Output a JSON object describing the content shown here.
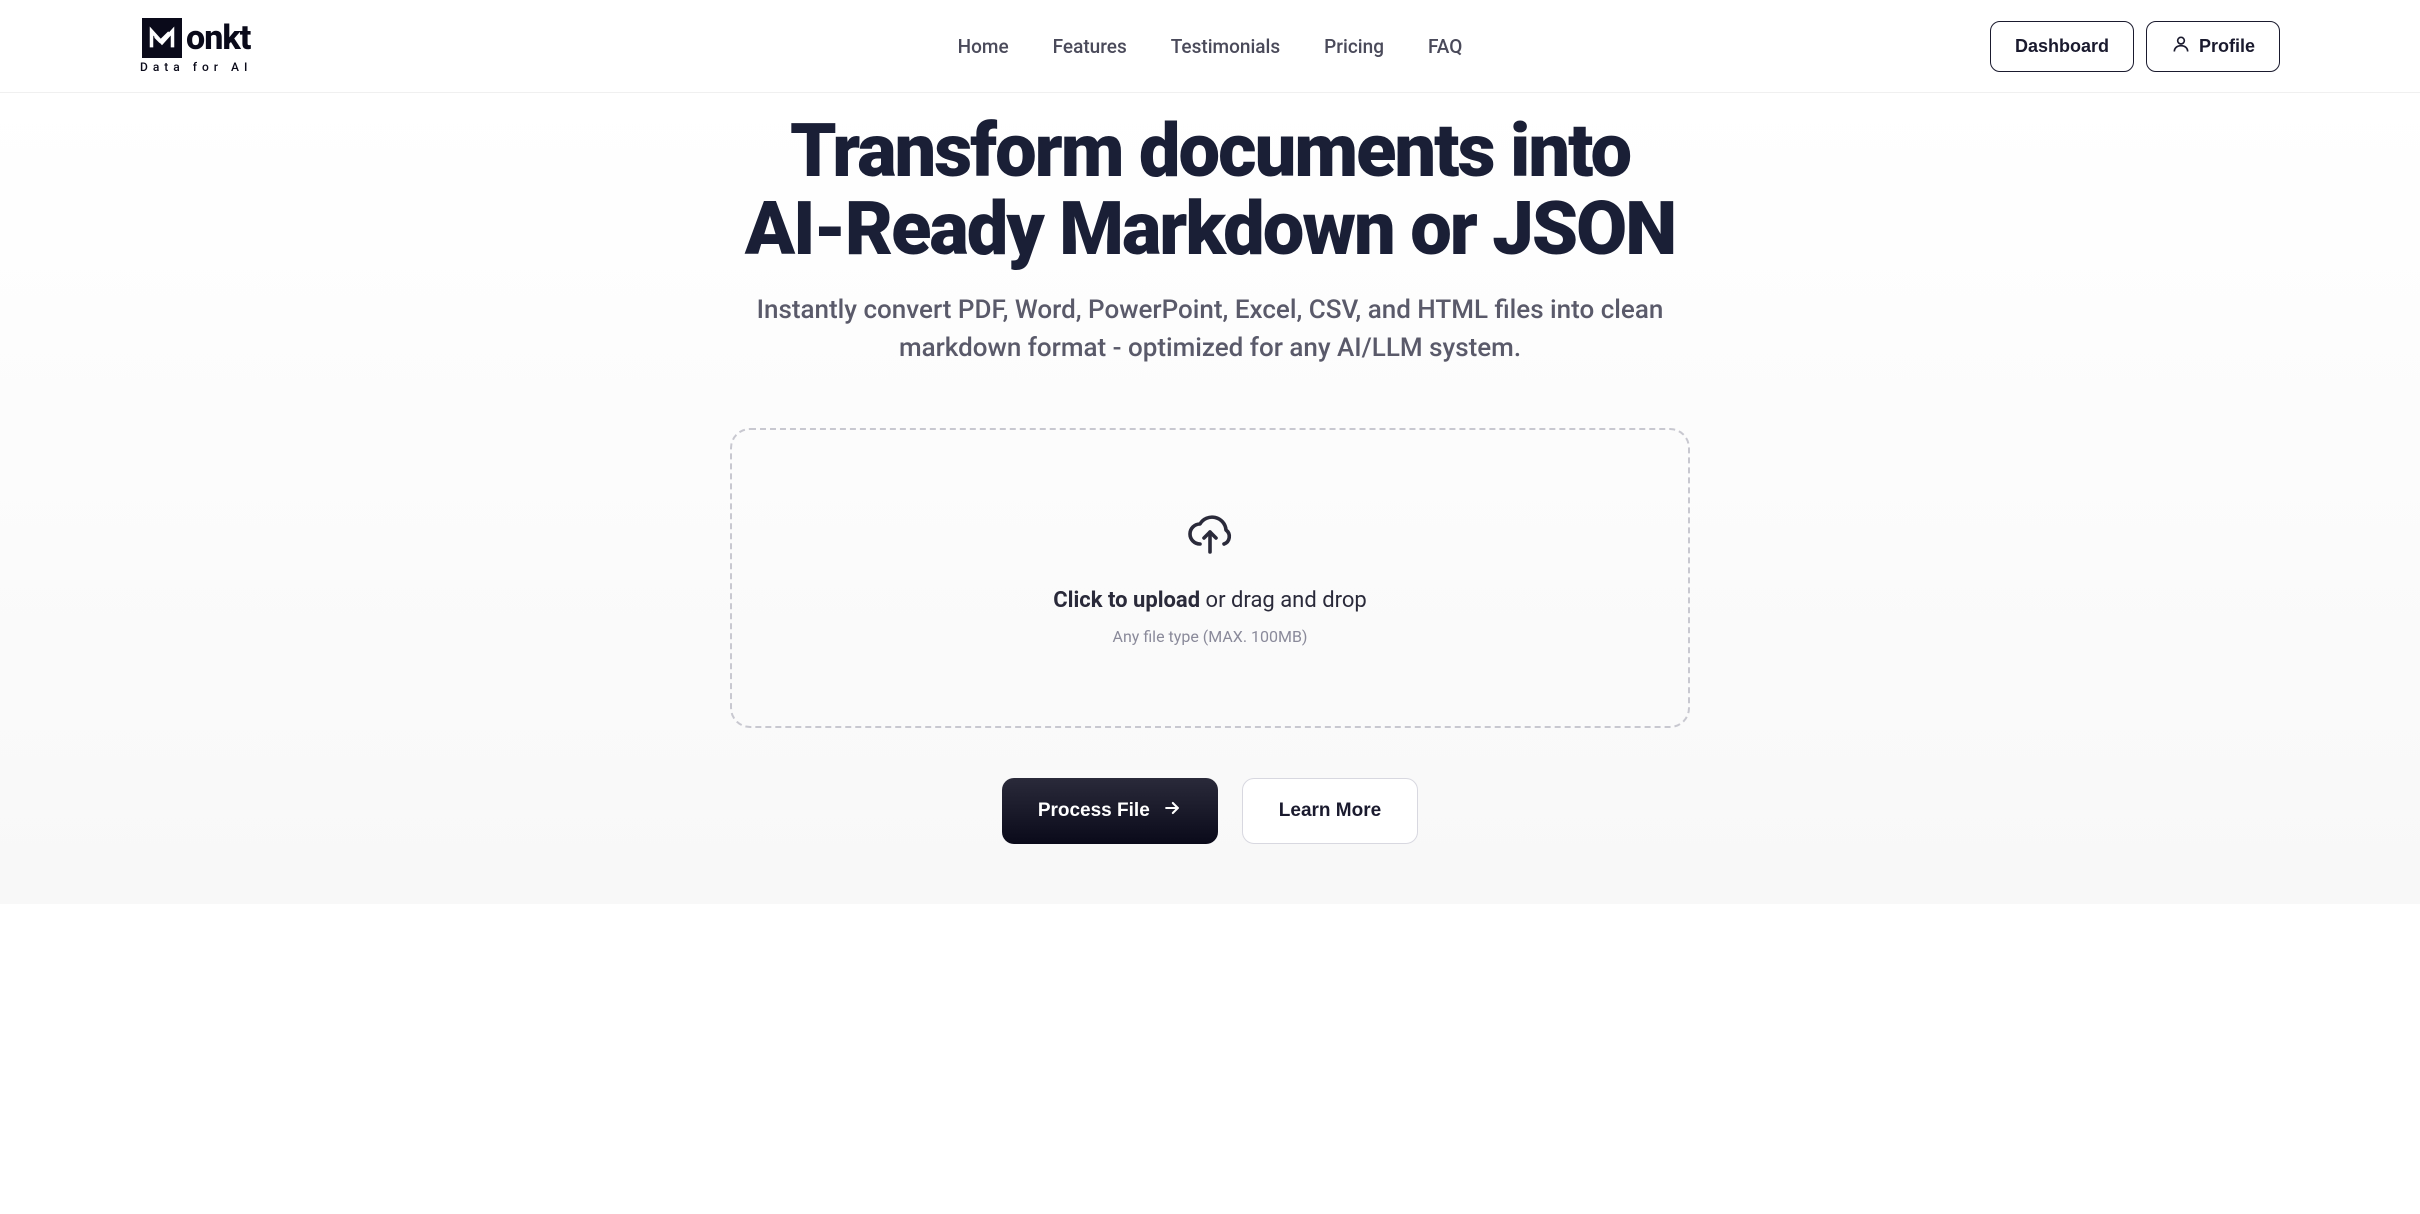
{
  "logo": {
    "brand": "onkt",
    "tagline": "Data for AI"
  },
  "nav": {
    "items": [
      "Home",
      "Features",
      "Testimonials",
      "Pricing",
      "FAQ"
    ]
  },
  "header_actions": {
    "dashboard": "Dashboard",
    "profile": "Profile"
  },
  "hero": {
    "title_line1": "Transform documents into",
    "title_line2": "AI-Ready Markdown or JSON",
    "subtitle": "Instantly convert PDF, Word, PowerPoint, Excel, CSV, and HTML files into clean markdown format - optimized for any AI/LLM system."
  },
  "upload": {
    "text_bold": "Click to upload",
    "text_rest": " or drag and drop",
    "hint": "Any file type (MAX. 100MB)"
  },
  "cta": {
    "primary": "Process File",
    "secondary": "Learn More"
  }
}
